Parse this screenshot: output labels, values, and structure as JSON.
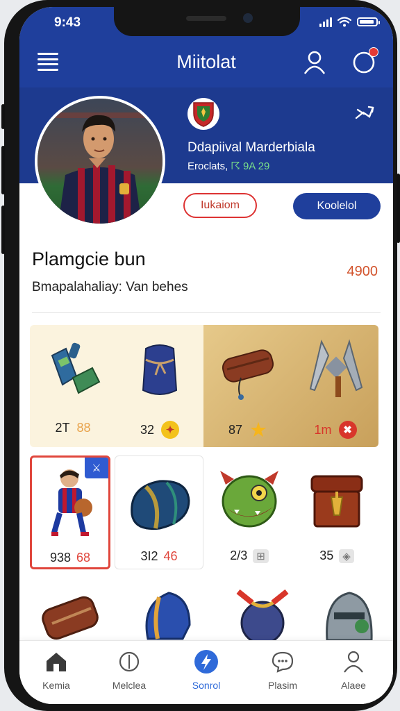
{
  "status_bar": {
    "time": "9:43"
  },
  "app_bar": {
    "title": "Miitolat"
  },
  "player": {
    "name": "Ddapiival Marderbiala",
    "subtitle": "Eroclats,",
    "subtitle_accent": "☈ 9A 29"
  },
  "actions": {
    "outline_label": "Iukaiom",
    "solid_label": "Koolelol"
  },
  "section": {
    "title": "Plamgcie bun",
    "subtitle": "Bmapalahaliay: Van behes",
    "coins": "4900"
  },
  "items_row1": [
    {
      "name": "shin-guards",
      "count": "2T",
      "price": "88",
      "price_color": "#e8a24a"
    },
    {
      "name": "sack",
      "count": "32",
      "badge": "✦",
      "badge_color": "#f3c21c"
    },
    {
      "name": "drum",
      "count": "87",
      "badge": "★",
      "badge_color": "#f6b51c"
    },
    {
      "name": "daggers",
      "count": "1m",
      "badge": "✖",
      "badge_color": "#d8362b"
    }
  ],
  "items_row2": [
    {
      "name": "player-figure",
      "count": "938",
      "price": "68",
      "corner_badge": "⚔",
      "selected": true
    },
    {
      "name": "armor-pad",
      "count": "3I2",
      "price": "46"
    },
    {
      "name": "monster-head",
      "count": "2/3",
      "price": "⊞"
    },
    {
      "name": "treasure-chest",
      "count": "35",
      "price": "◈"
    }
  ],
  "nav": [
    {
      "label": "Kemia",
      "icon": "home-icon"
    },
    {
      "label": "Melclea",
      "icon": "compass-icon"
    },
    {
      "label": "Sonrol",
      "icon": "lightning-icon",
      "active": true
    },
    {
      "label": "Plasim",
      "icon": "chat-icon"
    },
    {
      "label": "Alaee",
      "icon": "profile-icon"
    }
  ],
  "colors": {
    "brand": "#1f3f9c",
    "accent_red": "#e0463c",
    "active_nav": "#2f6ad9"
  }
}
